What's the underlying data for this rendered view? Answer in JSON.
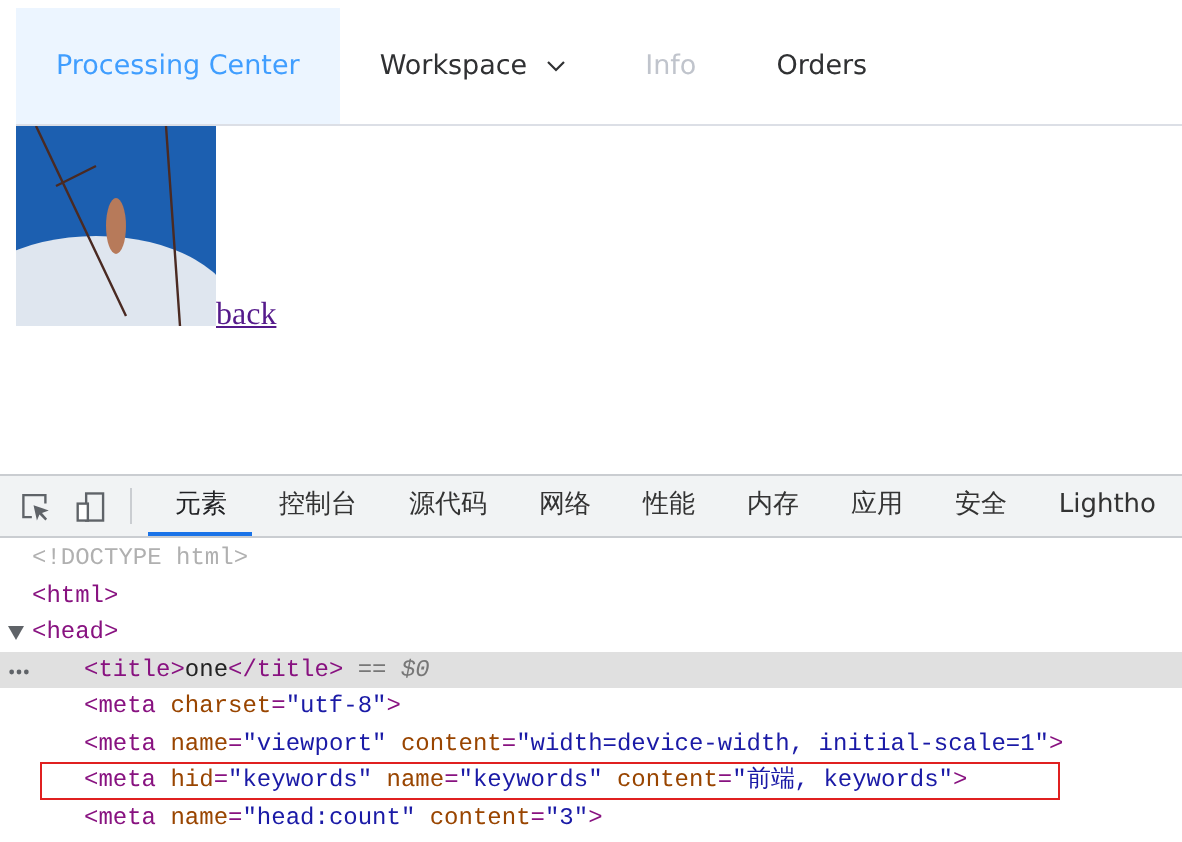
{
  "menu": [
    {
      "label": "Processing Center",
      "selected": true,
      "disabled": false,
      "dropdown": false
    },
    {
      "label": "Workspace",
      "selected": false,
      "disabled": false,
      "dropdown": true
    },
    {
      "label": "Info",
      "selected": false,
      "disabled": true,
      "dropdown": false
    },
    {
      "label": "Orders",
      "selected": false,
      "disabled": false,
      "dropdown": false
    }
  ],
  "content": {
    "link": "back"
  },
  "devtools": {
    "tabs": [
      {
        "label": "元素",
        "selected": true
      },
      {
        "label": "控制台",
        "selected": false
      },
      {
        "label": "源代码",
        "selected": false
      },
      {
        "label": "网络",
        "selected": false
      },
      {
        "label": "性能",
        "selected": false
      },
      {
        "label": "内存",
        "selected": false
      },
      {
        "label": "应用",
        "selected": false
      },
      {
        "label": "安全",
        "selected": false
      },
      {
        "label": "Lightho",
        "selected": false
      }
    ],
    "nodes": [
      {
        "selected": false,
        "boxed": false,
        "tokens": [
          {
            "kind": "doctype",
            "text": "<!DOCTYPE html>"
          }
        ]
      },
      {
        "selected": false,
        "boxed": false,
        "tokens": [
          {
            "kind": "tag",
            "text": "<html>"
          }
        ]
      },
      {
        "selected": false,
        "boxed": false,
        "expanded": true,
        "tokens": [
          {
            "kind": "tag",
            "text": "<head>"
          }
        ],
        "children": [
          {
            "selected": true,
            "boxed": false,
            "tokens": [
              {
                "kind": "tag",
                "text": "<title>"
              },
              {
                "kind": "text",
                "text": "one"
              },
              {
                "kind": "tag",
                "text": "</title>"
              },
              {
                "kind": "note",
                "text": " == $0"
              }
            ]
          },
          {
            "selected": false,
            "boxed": false,
            "tokens": [
              {
                "kind": "tag",
                "text": "<meta"
              },
              {
                "kind": "attr",
                "text": " charset"
              },
              {
                "kind": "tag",
                "text": "="
              },
              {
                "kind": "value",
                "text": "\"utf-8\""
              },
              {
                "kind": "tag",
                "text": ">"
              }
            ]
          },
          {
            "selected": false,
            "boxed": false,
            "tokens": [
              {
                "kind": "tag",
                "text": "<meta"
              },
              {
                "kind": "attr",
                "text": " name"
              },
              {
                "kind": "tag",
                "text": "="
              },
              {
                "kind": "value",
                "text": "\"viewport\""
              },
              {
                "kind": "attr",
                "text": " content"
              },
              {
                "kind": "tag",
                "text": "="
              },
              {
                "kind": "value",
                "text": "\"width=device-width, initial-scale=1\""
              },
              {
                "kind": "tag",
                "text": ">"
              }
            ]
          },
          {
            "selected": false,
            "boxed": true,
            "tokens": [
              {
                "kind": "tag",
                "text": "<meta"
              },
              {
                "kind": "attr",
                "text": " hid"
              },
              {
                "kind": "tag",
                "text": "="
              },
              {
                "kind": "value",
                "text": "\"keywords\""
              },
              {
                "kind": "attr",
                "text": " name"
              },
              {
                "kind": "tag",
                "text": "="
              },
              {
                "kind": "value",
                "text": "\"keywords\""
              },
              {
                "kind": "attr",
                "text": " content"
              },
              {
                "kind": "tag",
                "text": "="
              },
              {
                "kind": "value",
                "text": "\"前端, keywords\""
              },
              {
                "kind": "tag",
                "text": ">"
              }
            ]
          },
          {
            "selected": false,
            "boxed": false,
            "tokens": [
              {
                "kind": "tag",
                "text": "<meta"
              },
              {
                "kind": "attr",
                "text": " name"
              },
              {
                "kind": "tag",
                "text": "="
              },
              {
                "kind": "value",
                "text": "\"head:count\""
              },
              {
                "kind": "attr",
                "text": " content"
              },
              {
                "kind": "tag",
                "text": "="
              },
              {
                "kind": "value",
                "text": "\"3\""
              },
              {
                "kind": "tag",
                "text": ">"
              }
            ]
          }
        ]
      }
    ]
  }
}
